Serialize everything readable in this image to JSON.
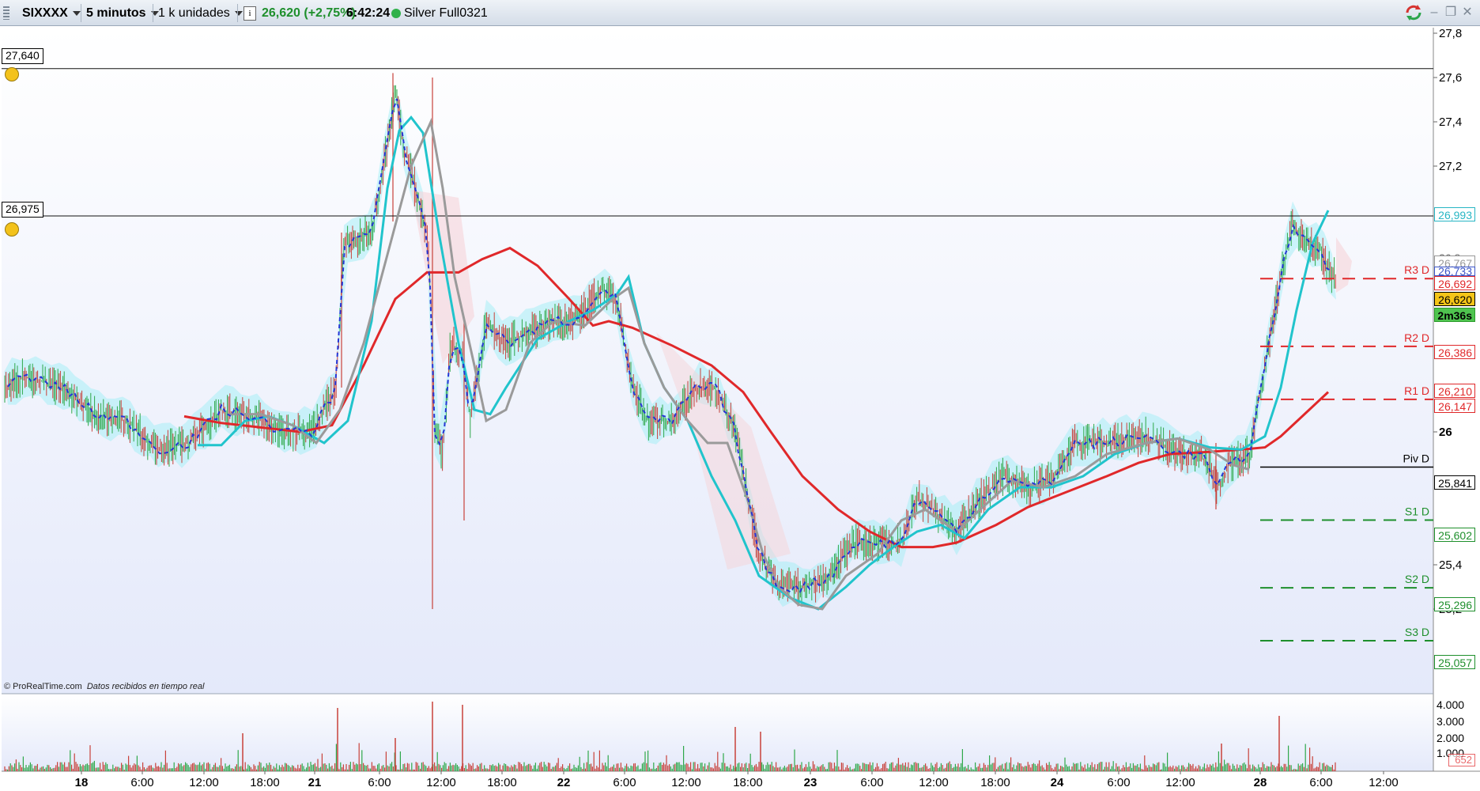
{
  "toolbar": {
    "symbol": "SIXXXX",
    "timeframe": "5 minutos",
    "units": "1 k unidades",
    "info_icon": "i",
    "last_price_change": "26,620 (+2,75%)",
    "time": "6:42:24",
    "connection_label": "Silver Full0321",
    "refresh_icon": "sync-icon",
    "minimize_label": "–",
    "restore_label": "❐",
    "close_label": "✕"
  },
  "chart": {
    "watermark": "© ProRealTime.com",
    "watermark_note": "Datos recibidos en tiempo real",
    "price_axis_ticks": [
      "27,8",
      "27,6",
      "27,4",
      "27,2",
      "26",
      "25,4",
      "25,2"
    ],
    "price_axis_partial": [
      "26,8"
    ],
    "time_axis_ticks": [
      "18",
      "6:00",
      "12:00",
      "18:00",
      "21",
      "6:00",
      "12:00",
      "18:00",
      "22",
      "6:00",
      "12:00",
      "18:00",
      "23",
      "6:00",
      "12:00",
      "18:00",
      "24",
      "6:00",
      "12:00",
      "28",
      "6:00",
      "12:00"
    ],
    "time_axis_bold": [
      "18",
      "21",
      "22",
      "23",
      "24",
      "28"
    ],
    "horizontal_levels": [
      {
        "label": "27,640",
        "value": 27.64
      },
      {
        "label": "26,975",
        "value": 26.975
      }
    ],
    "pivot_levels": [
      {
        "name": "R3 D",
        "value": 26.692,
        "label": "26,692",
        "color": "#e0282a"
      },
      {
        "name": "R2 D",
        "value": 26.386,
        "label": "26,386",
        "color": "#e0282a"
      },
      {
        "name": "R1 D",
        "value": 26.147,
        "label": "26,147",
        "color": "#e0282a"
      },
      {
        "name": "Piv D",
        "value": 25.841,
        "label": "25,841",
        "color": "#000000"
      },
      {
        "name": "S1 D",
        "value": 25.602,
        "label": "25,602",
        "color": "#1e8f2c"
      },
      {
        "name": "S2 D",
        "value": 25.296,
        "label": "25,296",
        "color": "#1e8f2c"
      },
      {
        "name": "S3 D",
        "value": 25.057,
        "label": "25,057",
        "color": "#1e8f2c"
      }
    ],
    "price_labels": [
      {
        "label": "26,993",
        "color": "#27b6c4"
      },
      {
        "label": "26,767",
        "color": "#999999"
      },
      {
        "label": "26,733",
        "color": "#3b55c8"
      },
      {
        "label": "26,620",
        "color": "#000000",
        "bg": "#f5c518"
      },
      {
        "label": "2m36s",
        "color": "#000000",
        "bg": "#4fc44f"
      },
      {
        "label": "26,210",
        "color": "#e0282a"
      }
    ],
    "volume_ticks": [
      "4.000",
      "3.000",
      "2.000",
      "1.000"
    ],
    "volume_last": "652",
    "colors": {
      "ma_red": "#e0282a",
      "ma_cyan": "#21c4cc",
      "ma_gray": "#9a9a9a",
      "ma_blue": "#2536d6",
      "up": "#2ea84a",
      "down": "#c8413a",
      "cloud": "#a8eef6",
      "cloud_pink": "#f6d4d8"
    }
  }
}
